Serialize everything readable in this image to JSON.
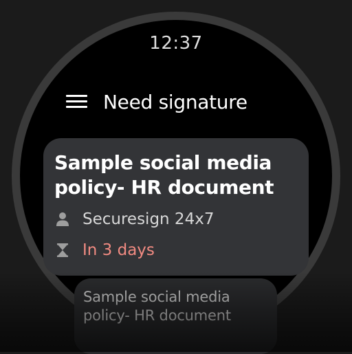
{
  "status_bar": {
    "time": "12:37"
  },
  "header": {
    "title": "Need signature",
    "menu_icon": "hamburger-menu-icon"
  },
  "documents": [
    {
      "title": "Sample social media policy- HR document",
      "sender": "Securesign 24x7",
      "due": "In 3 days",
      "sender_icon": "person-icon",
      "due_icon": "hourglass-icon"
    },
    {
      "title": "Sample social media policy- HR document"
    }
  ],
  "colors": {
    "background": "#000000",
    "card": "#333437",
    "due_text": "#f28b82",
    "icon": "#9e9e9e"
  }
}
